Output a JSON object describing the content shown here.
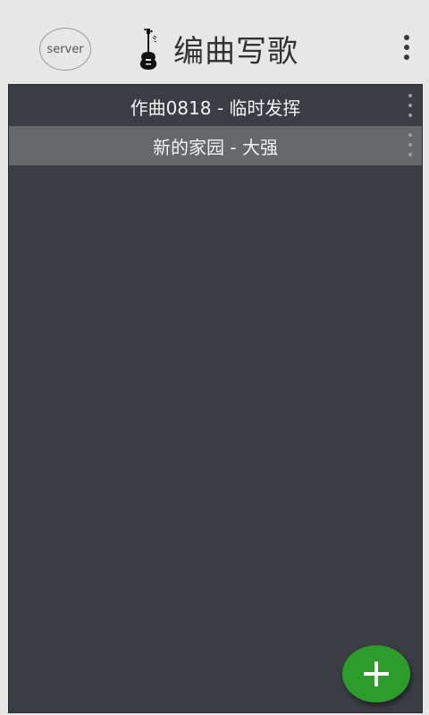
{
  "header": {
    "server_label": "server",
    "title": "编曲写歌",
    "guitar_icon": "guitar-icon",
    "menu_icon": "more-vertical-icon"
  },
  "songs": [
    {
      "label": "作曲0818 - 临时发挥",
      "selected": false
    },
    {
      "label": "新的家园 - 大强",
      "selected": true
    }
  ],
  "fab": {
    "icon": "plus-icon",
    "color": "#2d9c2c"
  },
  "colors": {
    "header_bg": "#e6e7e6",
    "list_bg": "#3c3d44",
    "selected_row_bg": "#676869"
  }
}
